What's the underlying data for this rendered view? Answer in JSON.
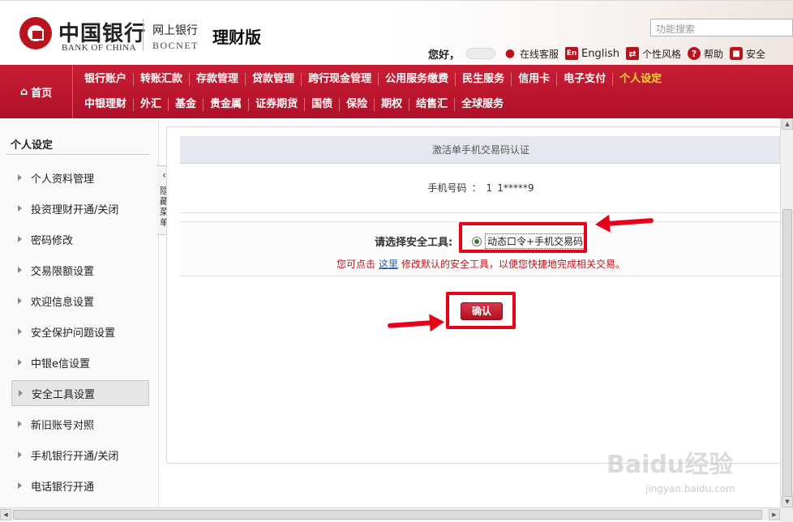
{
  "header": {
    "bank_name_cn": "中国银行",
    "bank_name_en": "BANK OF CHINA",
    "online_bank": "网上银行",
    "bocnet": "BOCNET",
    "edition": "理财版",
    "search_placeholder": "功能搜索",
    "greeting": "您好，",
    "tools": {
      "support": "在线客服",
      "english": "English",
      "english_badge": "En",
      "style": "个性风格",
      "help": "帮助",
      "security": "安全"
    }
  },
  "nav": {
    "home": "首页",
    "row1": [
      "银行账户",
      "转账汇款",
      "存款管理",
      "贷款管理",
      "跨行现金管理",
      "公用服务缴费",
      "民生服务",
      "信用卡",
      "电子支付",
      "个人设定"
    ],
    "row2": [
      "中银理财",
      "外汇",
      "基金",
      "贵金属",
      "证券期货",
      "国债",
      "保险",
      "期权",
      "结售汇",
      "全球服务"
    ],
    "active": "个人设定"
  },
  "sidebar": {
    "title": "个人设定",
    "items": [
      "个人资料管理",
      "投资理财开通/关闭",
      "密码修改",
      "交易限额设置",
      "欢迎信息设置",
      "安全保护问题设置",
      "中银e信设置",
      "安全工具设置",
      "新旧账号对照",
      "手机银行开通/关闭",
      "电话银行开通"
    ],
    "active": "安全工具设置",
    "collapse_label": "隐藏菜单"
  },
  "main": {
    "section_title": "激活单手机交易码认证",
    "phone_label": "手机号码",
    "phone_sep": "：",
    "phone_prefix": "1",
    "phone_value": "1*****9",
    "tool_label": "请选择安全工具:",
    "tool_option": "动态口令+手机交易码",
    "hint_before": "您可点击",
    "hint_link": "这里",
    "hint_after": "修改默认的安全工具，以便您快捷地完成相关交易。",
    "confirm": "确认"
  },
  "watermark": {
    "brand": "Baidu经验",
    "url": "jingyan.baidu.com"
  },
  "colors": {
    "brand_red": "#b9131e",
    "nav_active": "#ffd83a",
    "hint_red": "#c0121c",
    "link_blue": "#1a5fb4",
    "annotation_red": "#e8001a"
  }
}
